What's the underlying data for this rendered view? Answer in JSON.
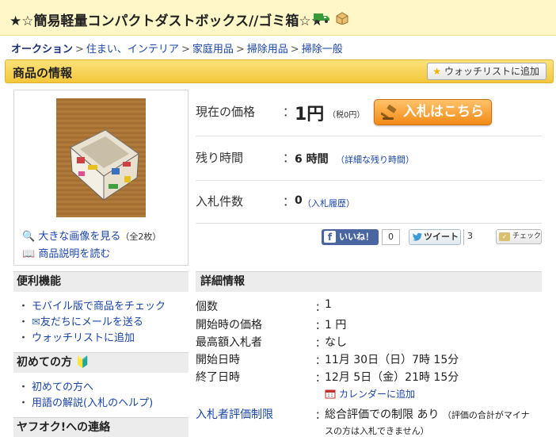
{
  "title": "★☆簡易軽量コンパクトダストボックス//ゴミ箱☆★",
  "breadcrumb": [
    "オークション",
    "住まい、インテリア",
    "家庭用品",
    "掃除用品",
    "掃除一般"
  ],
  "section": {
    "title": "商品の情報",
    "watchlist_button": "ウォッチリストに追加"
  },
  "image_panel": {
    "enlarge": "大きな画像を見る",
    "count": "（全2枚）",
    "description": "商品説明を読む"
  },
  "price": {
    "label": "現在の価格",
    "colon": "：",
    "value": "1円",
    "tax": "（税0円）",
    "bid_button": "入札はこちら"
  },
  "remaining": {
    "label": "残り時間",
    "colon": "：",
    "value": "6 時間",
    "link": "（詳細な残り時間）"
  },
  "bids": {
    "label": "入札件数",
    "colon": "：",
    "value": "0",
    "link": "（入札履歴）"
  },
  "social": {
    "like": "いいね！",
    "like_count": "0",
    "tweet": "ツイート",
    "tweet_count": "3",
    "check": "チェック"
  },
  "sidebar": {
    "convenience": {
      "title": "便利機能",
      "items": [
        "モバイル版で商品をチェック",
        "友だちにメールを送る",
        "ウォッチリストに追加"
      ]
    },
    "beginners": {
      "title": "初めての方",
      "items": [
        "初めての方へ",
        "用語の解説(入札のヘルプ)"
      ]
    },
    "contact": {
      "title": "ヤフオク!への連絡"
    }
  },
  "details": {
    "title": "詳細情報",
    "rows": [
      {
        "label": "個数",
        "value": "1"
      },
      {
        "label": "開始時の価格",
        "value": "1 円"
      },
      {
        "label": "最高額入札者",
        "value": "なし"
      },
      {
        "label": "開始日時",
        "value": "11月 30日（日）7時 15分"
      },
      {
        "label": "終了日時",
        "value": "12月 5日（金）21時 15分"
      }
    ],
    "calendar_link": "カレンダーに追加",
    "restriction": {
      "label": "入札者評価制限",
      "value": "総合評価での制限 あり",
      "note1": "（評価の合計がマイナ",
      "note2": "スの方は入札できません）"
    },
    "colon": "："
  },
  "colors": {
    "accent": "#f3c63a",
    "link": "#1a45a8",
    "bid_button": "#f28a14"
  }
}
